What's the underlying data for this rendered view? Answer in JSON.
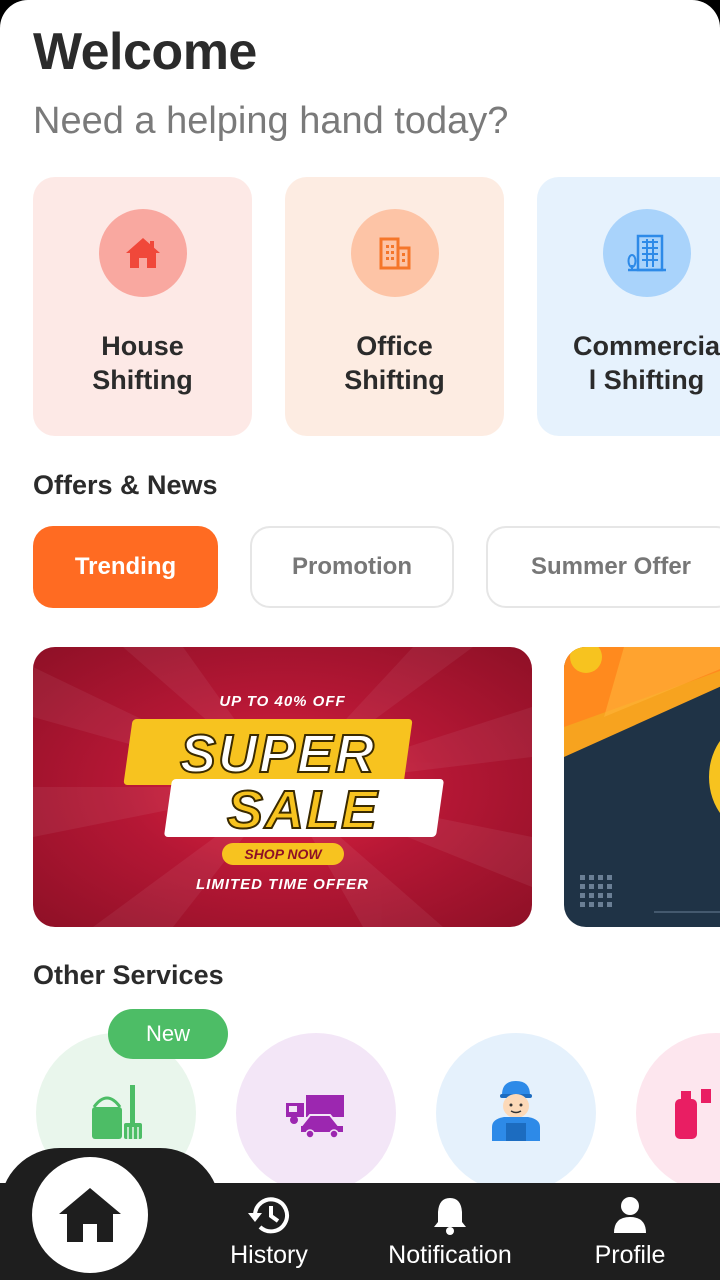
{
  "header": {
    "title": "Welcome",
    "subtitle": "Need a helping hand today?"
  },
  "categories": [
    {
      "label": "House\nShifting",
      "icon": "house-icon",
      "bg": "#fde9e6",
      "icon_bg": "#f9a8a0",
      "icon_color": "#f0483a"
    },
    {
      "label": "Office\nShifting",
      "icon": "office-building-icon",
      "bg": "#fdece2",
      "icon_bg": "#fdc4a6",
      "icon_color": "#f5762a"
    },
    {
      "label": "Commercia\nl Shifting",
      "icon": "commercial-building-icon",
      "bg": "#e6f2fd",
      "icon_bg": "#a9d3fb",
      "icon_color": "#2d8ae8"
    }
  ],
  "offers": {
    "title": "Offers & News",
    "chips": [
      {
        "label": "Trending",
        "active": true
      },
      {
        "label": "Promotion",
        "active": false
      },
      {
        "label": "Summer Offer",
        "active": false
      }
    ],
    "banner": {
      "top_text": "UP TO 40% OFF",
      "headline_1": "SUPER",
      "headline_2": "SALE",
      "cta": "SHOP NOW",
      "bottom_text": "LIMITED TIME OFFER"
    }
  },
  "other_services": {
    "title": "Other Services",
    "badge": "New",
    "items": [
      {
        "icon": "cleaning-bucket-mop-icon",
        "bg": "#e9f6ec"
      },
      {
        "icon": "truck-car-icon",
        "bg": "#f3e6f7"
      },
      {
        "icon": "worker-icon",
        "bg": "#e5f1fc"
      },
      {
        "icon": "bottle-icon",
        "bg": "#fde6ee"
      }
    ]
  },
  "nav": {
    "home": "home-icon",
    "history": "History",
    "notification": "Notification",
    "profile": "Profile"
  },
  "colors": {
    "accent": "#ff6b22",
    "navbar": "#1e1e1e",
    "badge_green": "#4dbd66"
  }
}
